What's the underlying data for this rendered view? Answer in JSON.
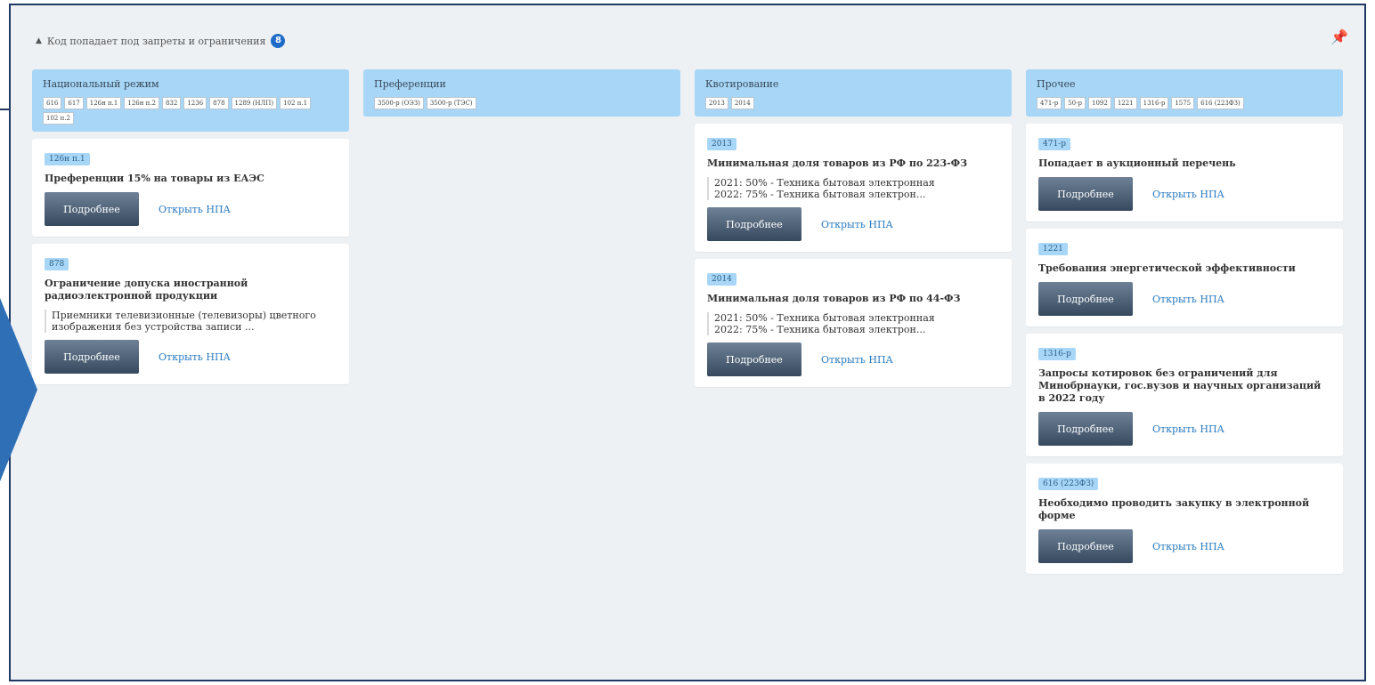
{
  "header": {
    "title": "Код попадает под запреты и ограничения",
    "count": "8"
  },
  "button_label": "Подробнее",
  "link_label": "Открыть НПА",
  "columns": [
    {
      "title": "Национальный режим",
      "chips": [
        "616",
        "617",
        "126н п.1",
        "126н п.2",
        "832",
        "1236",
        "878",
        "1289 (НЛП)",
        "102 п.1",
        "102 п.2"
      ],
      "cards": [
        {
          "tag": "126н п.1",
          "title": "Преференции 15% на товары из ЕАЭС",
          "desc": ""
        },
        {
          "tag": "878",
          "title": "Ограничение допуска иностранной радиоэлектронной продукции",
          "desc": "Приемники телевизионные (телевизоры) цветного изображения без устройства записи ..."
        }
      ]
    },
    {
      "title": "Преференции",
      "chips": [
        "3500-р (ОЭЗ)",
        "3500-р (ТЭС)"
      ],
      "cards": []
    },
    {
      "title": "Квотирование",
      "chips": [
        "2013",
        "2014"
      ],
      "cards": [
        {
          "tag": "2013",
          "title": "Минимальная доля товаров из РФ по 223-ФЗ",
          "desc": "2021: 50% - Техника бытовая электронная\n2022: 75% - Техника бытовая электрон..."
        },
        {
          "tag": "2014",
          "title": "Минимальная доля товаров из РФ по 44-ФЗ",
          "desc": "2021: 50% - Техника бытовая электронная\n2022: 75% - Техника бытовая электрон..."
        }
      ]
    },
    {
      "title": "Прочее",
      "chips": [
        "471-р",
        "50-р",
        "1092",
        "1221",
        "1316-р",
        "1575",
        "616 (223ФЗ)"
      ],
      "cards": [
        {
          "tag": "471-р",
          "title": "Попадает в аукционный перечень",
          "desc": ""
        },
        {
          "tag": "1221",
          "title": "Требования энергетической эффективности",
          "desc": ""
        },
        {
          "tag": "1316-р",
          "title": "Запросы котировок без ограничений для Минобрнауки, гос.вузов и научных организаций в 2022 году",
          "desc": ""
        },
        {
          "tag": "616 (223ФЗ)",
          "title": "Необходимо проводить закупку в электронной форме",
          "desc": ""
        }
      ]
    }
  ]
}
